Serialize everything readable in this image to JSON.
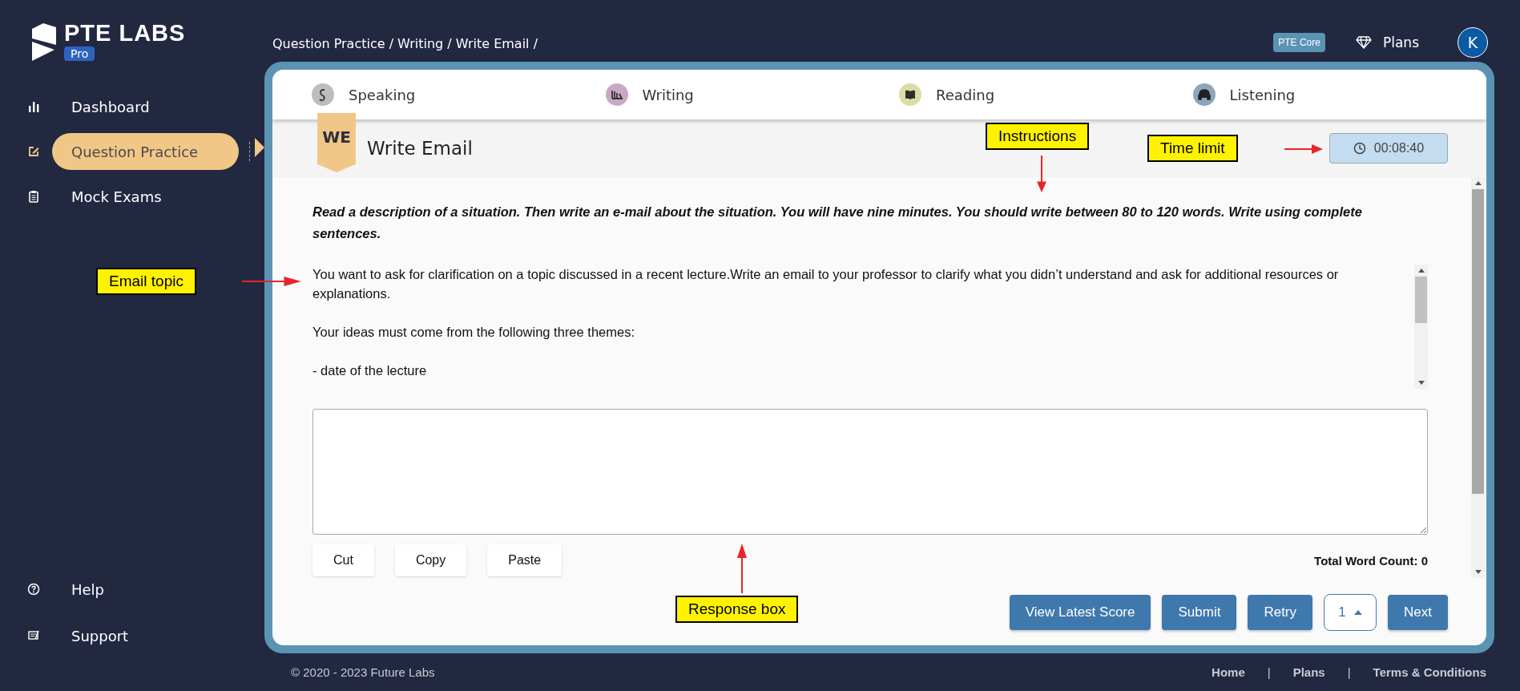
{
  "brand": {
    "name": "PTE LABS",
    "badge": "Pro"
  },
  "sidebar": {
    "items": [
      {
        "label": "Dashboard",
        "selected": false
      },
      {
        "label": "Question Practice",
        "selected": true
      },
      {
        "label": "Mock Exams",
        "selected": false
      }
    ],
    "bottom_items": [
      {
        "label": "Help"
      },
      {
        "label": "Support"
      }
    ]
  },
  "breadcrumb": "Question Practice / Writing / Write Email /",
  "top_bar": {
    "product_badge": "PTE Core",
    "plans": "Plans",
    "avatar": "K"
  },
  "tabs": [
    {
      "label": "Speaking",
      "color": "#bdbdbd"
    },
    {
      "label": "Writing",
      "color": "#c9a8c6"
    },
    {
      "label": "Reading",
      "color": "#dcdca6"
    },
    {
      "label": "Listening",
      "color": "#8fa5b9"
    }
  ],
  "question": {
    "code": "WE",
    "title": "Write Email",
    "timer": "00:08:40",
    "instructions": "Read a description of a situation. Then write an e-mail about the situation. You will have nine minutes. You should write between 80 to 120 words. Write using complete sentences.",
    "topic_paragraphs": [
      "You want to ask for clarification on a topic discussed in a recent lecture.Write an email to your professor to clarify what you didn’t understand and ask for additional resources or explanations.",
      "Your ideas must come from the following three themes:",
      "- date of the lecture"
    ],
    "edit_buttons": [
      "Cut",
      "Copy",
      "Paste"
    ],
    "word_count": "Total Word Count: 0"
  },
  "actions": [
    {
      "label": "View Latest Score",
      "kind": "button"
    },
    {
      "label": "Submit",
      "kind": "button"
    },
    {
      "label": "Retry",
      "kind": "button"
    },
    {
      "label": "1",
      "kind": "pager"
    },
    {
      "label": "Next",
      "kind": "button"
    }
  ],
  "footer": {
    "copyright": "© 2020 - 2023 Future Labs",
    "items": [
      {
        "text": "Home",
        "kind": "link"
      },
      {
        "text": "|",
        "kind": "separator"
      },
      {
        "text": "Plans",
        "kind": "link"
      },
      {
        "text": "|",
        "kind": "separator"
      },
      {
        "text": "Terms & Conditions",
        "kind": "link"
      }
    ]
  },
  "annotations": [
    "Instructions",
    "Time limit",
    "Email topic",
    "Response box"
  ]
}
